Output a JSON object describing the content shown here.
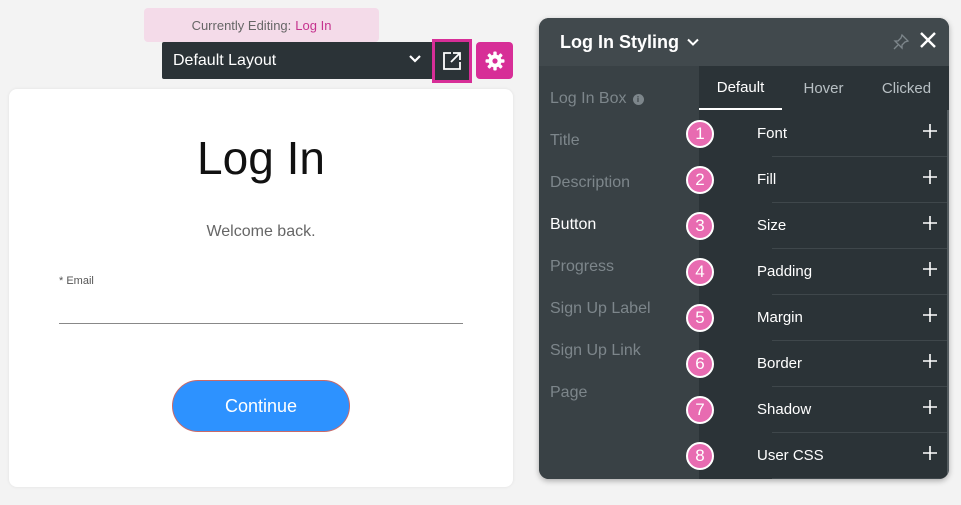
{
  "editing": {
    "prefix": "Currently Editing:",
    "target": "Log In"
  },
  "toolbar": {
    "layout_value": "Default Layout"
  },
  "card": {
    "title": "Log In",
    "description": "Welcome back.",
    "email_label": "* Email",
    "email_value": "",
    "continue_label": "Continue"
  },
  "panel": {
    "title": "Log In Styling",
    "side_items": [
      {
        "label": "Log In Box"
      },
      {
        "label": "Title"
      },
      {
        "label": "Description"
      },
      {
        "label": "Button"
      },
      {
        "label": "Progress"
      },
      {
        "label": "Sign Up Label"
      },
      {
        "label": "Sign Up Link"
      },
      {
        "label": "Page"
      }
    ],
    "tabs": [
      {
        "label": "Default"
      },
      {
        "label": "Hover"
      },
      {
        "label": "Clicked"
      }
    ],
    "properties": [
      {
        "step": "1",
        "label": "Font"
      },
      {
        "step": "2",
        "label": "Fill"
      },
      {
        "step": "3",
        "label": "Size"
      },
      {
        "step": "4",
        "label": "Padding"
      },
      {
        "step": "5",
        "label": "Margin"
      },
      {
        "step": "6",
        "label": "Border"
      },
      {
        "step": "7",
        "label": "Shadow"
      },
      {
        "step": "8",
        "label": "User CSS"
      }
    ]
  },
  "colors": {
    "accent": "#d72e97",
    "panel_bg": "#2b3337",
    "button_blue": "#2d92ff",
    "step_badge": "#e86bb1"
  }
}
